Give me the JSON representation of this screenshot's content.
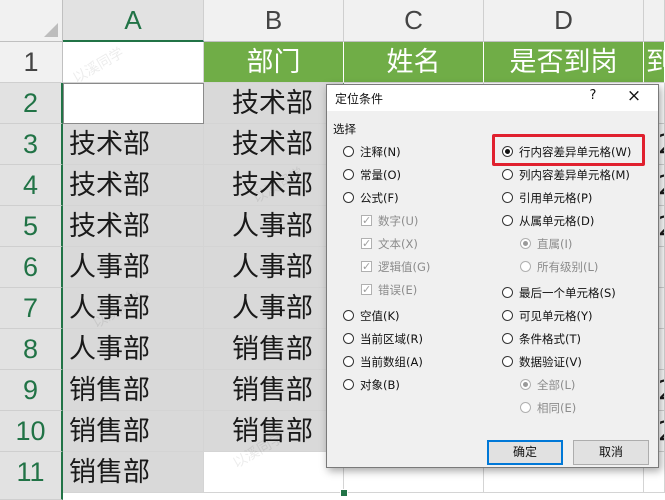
{
  "columns": [
    "A",
    "B",
    "C",
    "D"
  ],
  "rows": [
    "1",
    "2",
    "3",
    "4",
    "5",
    "6",
    "7",
    "8",
    "9",
    "10",
    "11"
  ],
  "header_row": {
    "B": "部门",
    "C": "姓名",
    "D": "是否到岗",
    "E_partial": "到"
  },
  "col_a": [
    "",
    "",
    "技术部",
    "技术部",
    "技术部",
    "人事部",
    "人事部",
    "人事部",
    "销售部",
    "销售部",
    "销售部"
  ],
  "col_b": [
    "",
    "技术部",
    "技术部",
    "技术部",
    "人事部",
    "人事部",
    "人事部",
    "销售部",
    "销售部",
    "销售部",
    ""
  ],
  "edge_digits": [
    "2",
    "2",
    "2",
    "2",
    "2"
  ],
  "dialog": {
    "title": "定位条件",
    "help": "?",
    "close": "×",
    "group_label": "选择",
    "left_options": {
      "comments": "注释(N)",
      "constants": "常量(O)",
      "formulas": "公式(F)",
      "numbers": "数字(U)",
      "text": "文本(X)",
      "logicals": "逻辑值(G)",
      "errors": "错误(E)",
      "blanks": "空值(K)",
      "current_region": "当前区域(R)",
      "current_array": "当前数组(A)",
      "objects": "对象(B)"
    },
    "right_options": {
      "row_differences": "行内容差异单元格(W)",
      "column_differences": "列内容差异单元格(M)",
      "precedents": "引用单元格(P)",
      "dependents": "从属单元格(D)",
      "direct_only": "直属(I)",
      "all_levels": "所有级别(L)",
      "last_cell": "最后一个单元格(S)",
      "visible_cells": "可见单元格(Y)",
      "conditional_formats": "条件格式(T)",
      "data_validation": "数据验证(V)",
      "all": "全部(L)",
      "same": "相同(E)"
    },
    "selected_option": "行内容差异单元格(W)",
    "ok": "确定",
    "cancel": "取消"
  },
  "watermark": "以溪同学",
  "colors": {
    "header_green": "#70ad47",
    "selection_gray": "#d9d9d9",
    "excel_green": "#217346",
    "highlight_red": "#e0202e"
  }
}
